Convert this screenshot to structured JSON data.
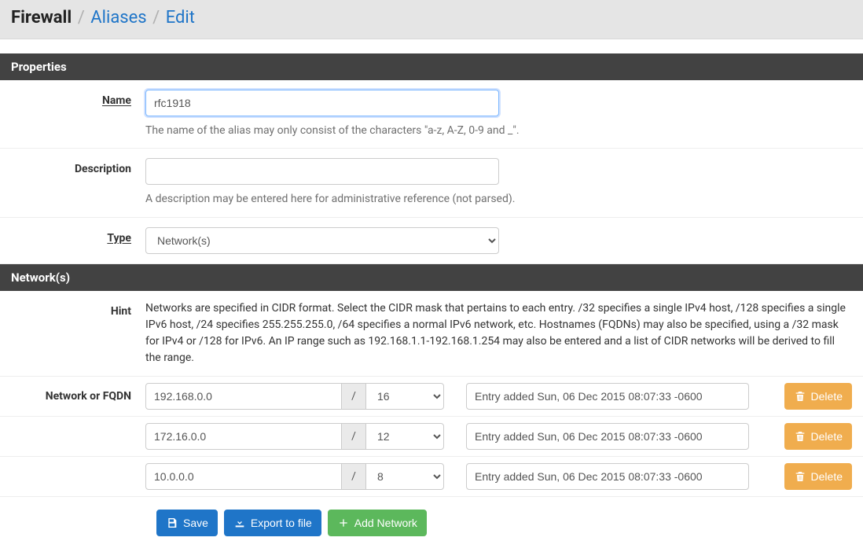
{
  "breadcrumb": {
    "root": "Firewall",
    "link1": "Aliases",
    "link2": "Edit"
  },
  "panels": {
    "properties": "Properties",
    "networks": "Network(s)"
  },
  "labels": {
    "name": "Name",
    "description": "Description",
    "type": "Type",
    "hint": "Hint",
    "network_or_fqdn": "Network or FQDN"
  },
  "fields": {
    "name_value": "rfc1918",
    "name_help": "The name of the alias may only consist of the characters \"a-z, A-Z, 0-9 and _\".",
    "description_value": "",
    "description_help": "A description may be entered here for administrative reference (not parsed).",
    "type_value": "Network(s)"
  },
  "hint_text": "Networks are specified in CIDR format. Select the CIDR mask that pertains to each entry. /32 specifies a single IPv4 host, /128 specifies a single IPv6 host, /24 specifies 255.255.255.0, /64 specifies a normal IPv6 network, etc. Hostnames (FQDNs) may also be specified, using a /32 mask for IPv4 or /128 for IPv6. An IP range such as 192.168.1.1-192.168.1.254 may also be entered and a list of CIDR networks will be derived to fill the range.",
  "networks_list": [
    {
      "addr": "192.168.0.0",
      "cidr": "16",
      "desc": "Entry added Sun, 06 Dec 2015 08:07:33 -0600"
    },
    {
      "addr": "172.16.0.0",
      "cidr": "12",
      "desc": "Entry added Sun, 06 Dec 2015 08:07:33 -0600"
    },
    {
      "addr": "10.0.0.0",
      "cidr": "8",
      "desc": "Entry added Sun, 06 Dec 2015 08:07:33 -0600"
    }
  ],
  "buttons": {
    "delete": "Delete",
    "save": "Save",
    "export": "Export to file",
    "add_network": "Add Network"
  },
  "slash": "/"
}
